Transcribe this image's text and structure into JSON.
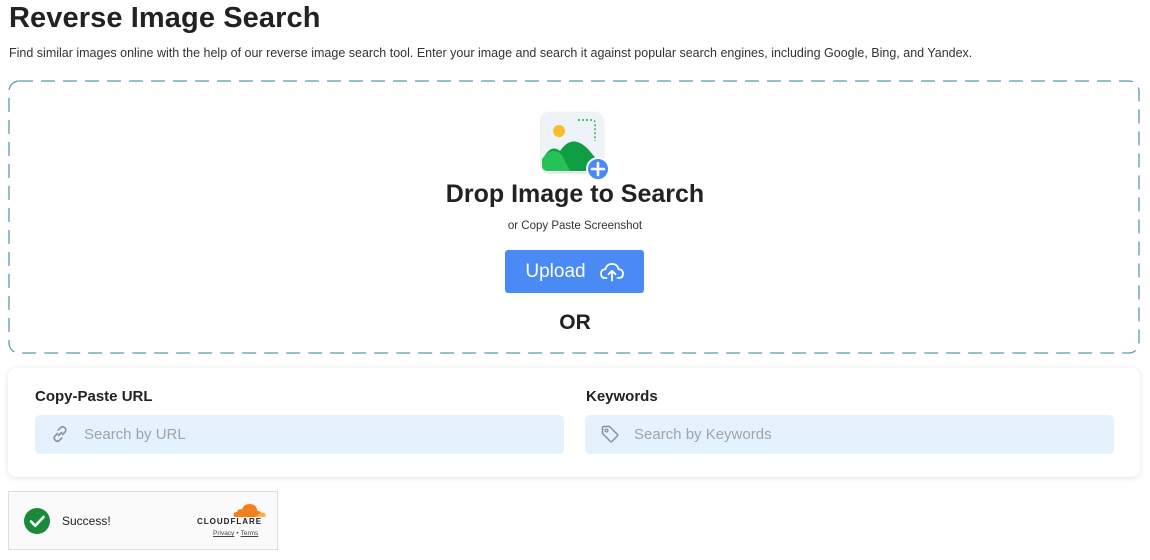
{
  "header": {
    "title": "Reverse Image Search",
    "description": "Find similar images online with the help of our reverse image search tool. Enter your image and search it against popular search engines, including Google, Bing, and Yandex."
  },
  "dropzone": {
    "icon": "image-add-icon",
    "title": "Drop Image to Search",
    "subtitle": "or Copy Paste Screenshot",
    "upload_label": "Upload",
    "upload_icon": "cloud-upload-icon",
    "or_label": "OR",
    "border_color": "#5a9aa8"
  },
  "search": {
    "url": {
      "label": "Copy-Paste URL",
      "placeholder": "Search by URL",
      "value": "",
      "icon": "link-icon"
    },
    "keywords": {
      "label": "Keywords",
      "placeholder": "Search by Keywords",
      "value": "",
      "icon": "tag-icon"
    }
  },
  "captcha": {
    "status": "Success!",
    "brand": "CLOUDFLARE",
    "privacy": "Privacy",
    "separator": "•",
    "terms": "Terms"
  },
  "colors": {
    "accent": "#4a8af4",
    "field_bg": "#e3f2fd",
    "success": "#1a8a3a",
    "cloudflare": "#f38020"
  }
}
